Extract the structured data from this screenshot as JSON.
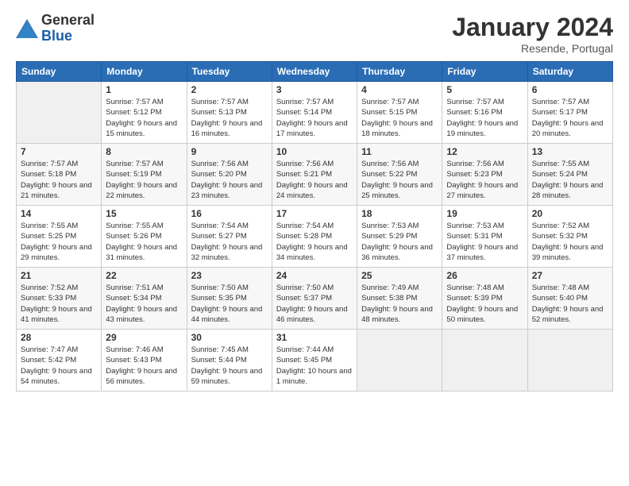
{
  "logo": {
    "general": "General",
    "blue": "Blue"
  },
  "header": {
    "month": "January 2024",
    "location": "Resende, Portugal"
  },
  "days_of_week": [
    "Sunday",
    "Monday",
    "Tuesday",
    "Wednesday",
    "Thursday",
    "Friday",
    "Saturday"
  ],
  "weeks": [
    [
      {
        "num": "",
        "sunrise": "",
        "sunset": "",
        "daylight": "",
        "empty": true
      },
      {
        "num": "1",
        "sunrise": "Sunrise: 7:57 AM",
        "sunset": "Sunset: 5:12 PM",
        "daylight": "Daylight: 9 hours and 15 minutes."
      },
      {
        "num": "2",
        "sunrise": "Sunrise: 7:57 AM",
        "sunset": "Sunset: 5:13 PM",
        "daylight": "Daylight: 9 hours and 16 minutes."
      },
      {
        "num": "3",
        "sunrise": "Sunrise: 7:57 AM",
        "sunset": "Sunset: 5:14 PM",
        "daylight": "Daylight: 9 hours and 17 minutes."
      },
      {
        "num": "4",
        "sunrise": "Sunrise: 7:57 AM",
        "sunset": "Sunset: 5:15 PM",
        "daylight": "Daylight: 9 hours and 18 minutes."
      },
      {
        "num": "5",
        "sunrise": "Sunrise: 7:57 AM",
        "sunset": "Sunset: 5:16 PM",
        "daylight": "Daylight: 9 hours and 19 minutes."
      },
      {
        "num": "6",
        "sunrise": "Sunrise: 7:57 AM",
        "sunset": "Sunset: 5:17 PM",
        "daylight": "Daylight: 9 hours and 20 minutes."
      }
    ],
    [
      {
        "num": "7",
        "sunrise": "Sunrise: 7:57 AM",
        "sunset": "Sunset: 5:18 PM",
        "daylight": "Daylight: 9 hours and 21 minutes."
      },
      {
        "num": "8",
        "sunrise": "Sunrise: 7:57 AM",
        "sunset": "Sunset: 5:19 PM",
        "daylight": "Daylight: 9 hours and 22 minutes."
      },
      {
        "num": "9",
        "sunrise": "Sunrise: 7:56 AM",
        "sunset": "Sunset: 5:20 PM",
        "daylight": "Daylight: 9 hours and 23 minutes."
      },
      {
        "num": "10",
        "sunrise": "Sunrise: 7:56 AM",
        "sunset": "Sunset: 5:21 PM",
        "daylight": "Daylight: 9 hours and 24 minutes."
      },
      {
        "num": "11",
        "sunrise": "Sunrise: 7:56 AM",
        "sunset": "Sunset: 5:22 PM",
        "daylight": "Daylight: 9 hours and 25 minutes."
      },
      {
        "num": "12",
        "sunrise": "Sunrise: 7:56 AM",
        "sunset": "Sunset: 5:23 PM",
        "daylight": "Daylight: 9 hours and 27 minutes."
      },
      {
        "num": "13",
        "sunrise": "Sunrise: 7:55 AM",
        "sunset": "Sunset: 5:24 PM",
        "daylight": "Daylight: 9 hours and 28 minutes."
      }
    ],
    [
      {
        "num": "14",
        "sunrise": "Sunrise: 7:55 AM",
        "sunset": "Sunset: 5:25 PM",
        "daylight": "Daylight: 9 hours and 29 minutes."
      },
      {
        "num": "15",
        "sunrise": "Sunrise: 7:55 AM",
        "sunset": "Sunset: 5:26 PM",
        "daylight": "Daylight: 9 hours and 31 minutes."
      },
      {
        "num": "16",
        "sunrise": "Sunrise: 7:54 AM",
        "sunset": "Sunset: 5:27 PM",
        "daylight": "Daylight: 9 hours and 32 minutes."
      },
      {
        "num": "17",
        "sunrise": "Sunrise: 7:54 AM",
        "sunset": "Sunset: 5:28 PM",
        "daylight": "Daylight: 9 hours and 34 minutes."
      },
      {
        "num": "18",
        "sunrise": "Sunrise: 7:53 AM",
        "sunset": "Sunset: 5:29 PM",
        "daylight": "Daylight: 9 hours and 36 minutes."
      },
      {
        "num": "19",
        "sunrise": "Sunrise: 7:53 AM",
        "sunset": "Sunset: 5:31 PM",
        "daylight": "Daylight: 9 hours and 37 minutes."
      },
      {
        "num": "20",
        "sunrise": "Sunrise: 7:52 AM",
        "sunset": "Sunset: 5:32 PM",
        "daylight": "Daylight: 9 hours and 39 minutes."
      }
    ],
    [
      {
        "num": "21",
        "sunrise": "Sunrise: 7:52 AM",
        "sunset": "Sunset: 5:33 PM",
        "daylight": "Daylight: 9 hours and 41 minutes."
      },
      {
        "num": "22",
        "sunrise": "Sunrise: 7:51 AM",
        "sunset": "Sunset: 5:34 PM",
        "daylight": "Daylight: 9 hours and 43 minutes."
      },
      {
        "num": "23",
        "sunrise": "Sunrise: 7:50 AM",
        "sunset": "Sunset: 5:35 PM",
        "daylight": "Daylight: 9 hours and 44 minutes."
      },
      {
        "num": "24",
        "sunrise": "Sunrise: 7:50 AM",
        "sunset": "Sunset: 5:37 PM",
        "daylight": "Daylight: 9 hours and 46 minutes."
      },
      {
        "num": "25",
        "sunrise": "Sunrise: 7:49 AM",
        "sunset": "Sunset: 5:38 PM",
        "daylight": "Daylight: 9 hours and 48 minutes."
      },
      {
        "num": "26",
        "sunrise": "Sunrise: 7:48 AM",
        "sunset": "Sunset: 5:39 PM",
        "daylight": "Daylight: 9 hours and 50 minutes."
      },
      {
        "num": "27",
        "sunrise": "Sunrise: 7:48 AM",
        "sunset": "Sunset: 5:40 PM",
        "daylight": "Daylight: 9 hours and 52 minutes."
      }
    ],
    [
      {
        "num": "28",
        "sunrise": "Sunrise: 7:47 AM",
        "sunset": "Sunset: 5:42 PM",
        "daylight": "Daylight: 9 hours and 54 minutes."
      },
      {
        "num": "29",
        "sunrise": "Sunrise: 7:46 AM",
        "sunset": "Sunset: 5:43 PM",
        "daylight": "Daylight: 9 hours and 56 minutes."
      },
      {
        "num": "30",
        "sunrise": "Sunrise: 7:45 AM",
        "sunset": "Sunset: 5:44 PM",
        "daylight": "Daylight: 9 hours and 59 minutes."
      },
      {
        "num": "31",
        "sunrise": "Sunrise: 7:44 AM",
        "sunset": "Sunset: 5:45 PM",
        "daylight": "Daylight: 10 hours and 1 minute."
      },
      {
        "num": "",
        "sunrise": "",
        "sunset": "",
        "daylight": "",
        "empty": true
      },
      {
        "num": "",
        "sunrise": "",
        "sunset": "",
        "daylight": "",
        "empty": true
      },
      {
        "num": "",
        "sunrise": "",
        "sunset": "",
        "daylight": "",
        "empty": true
      }
    ]
  ]
}
